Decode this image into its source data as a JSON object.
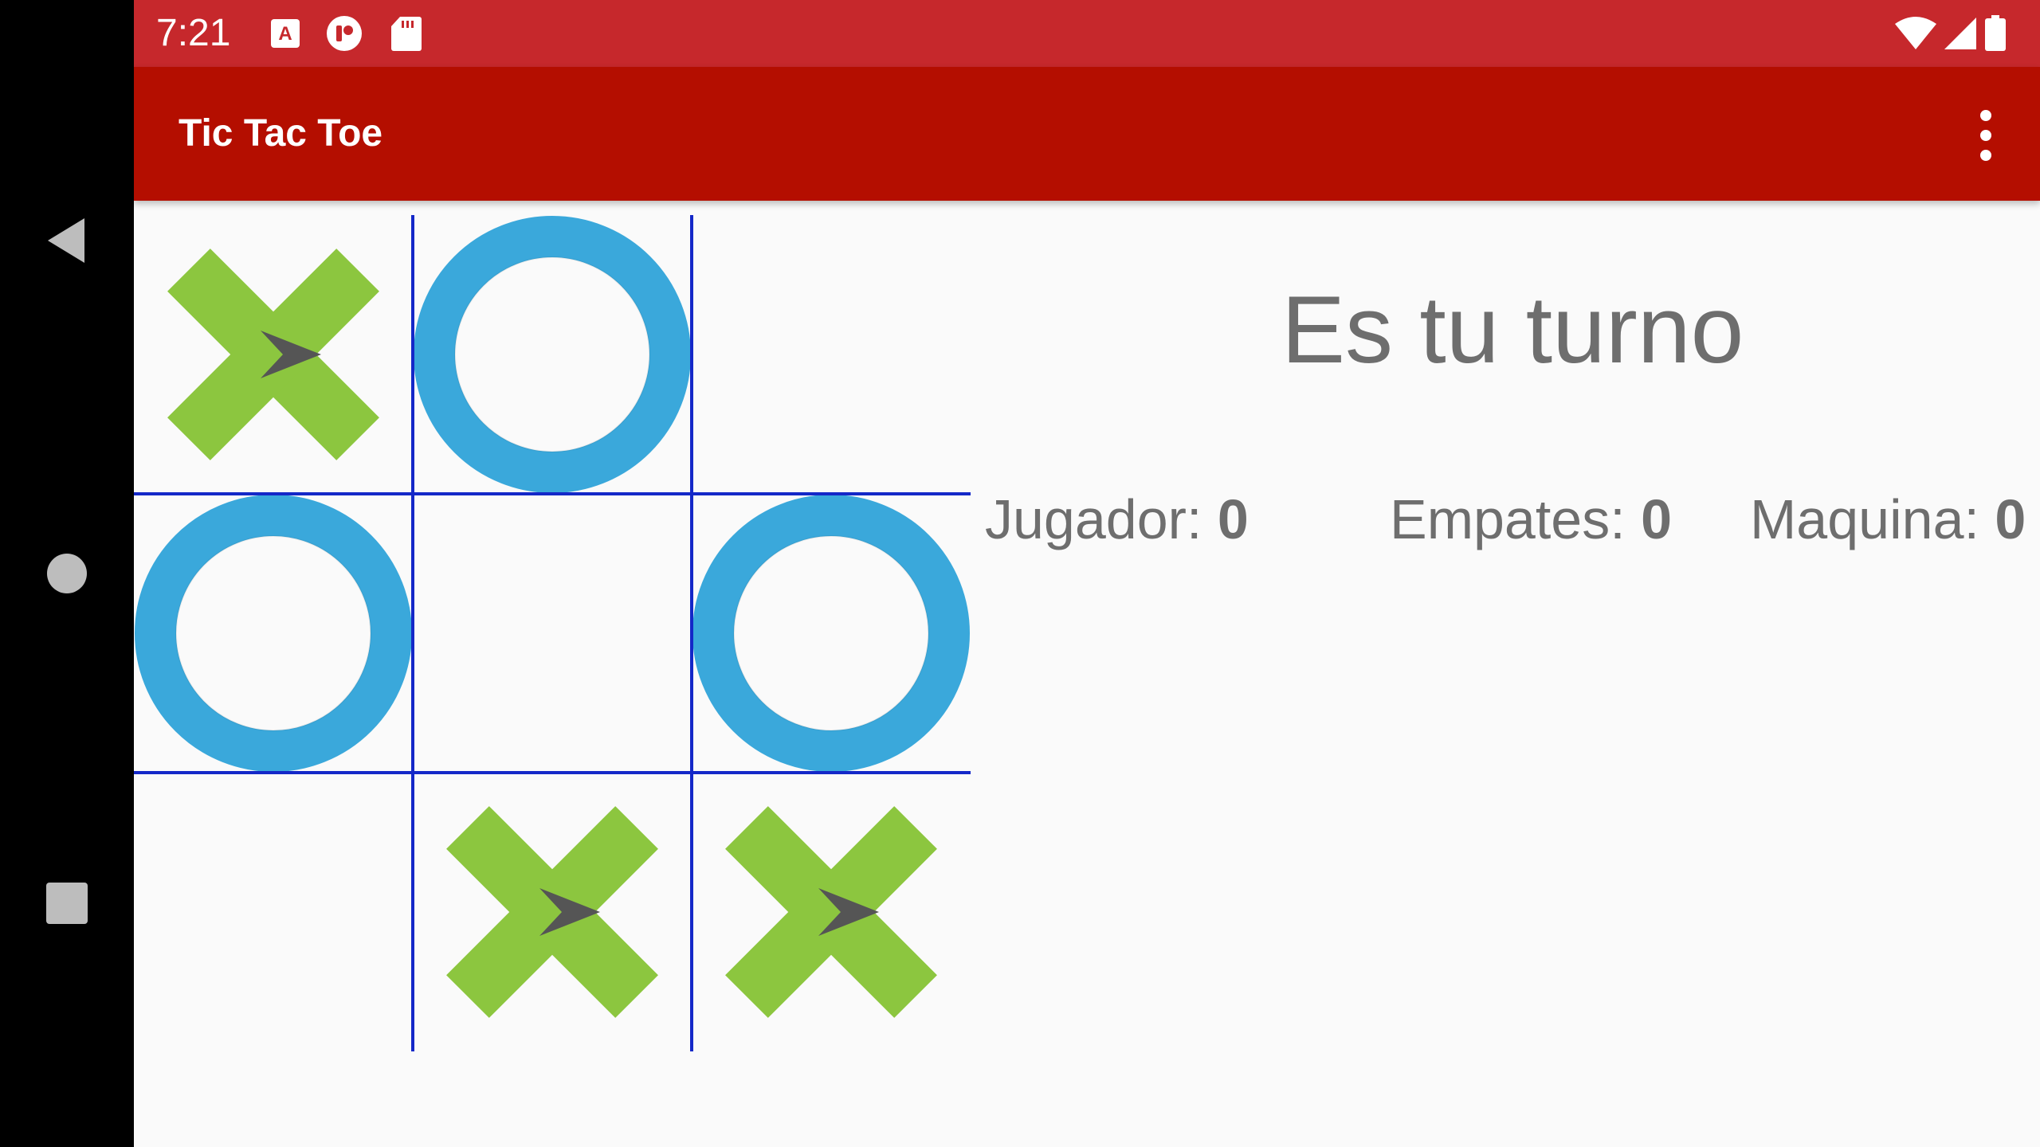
{
  "status_bar": {
    "time": "7:21",
    "icons": [
      "a-notification-icon",
      "opera-icon",
      "sd-card-icon",
      "wifi-icon",
      "signal-icon",
      "battery-icon"
    ]
  },
  "app_bar": {
    "title": "Tic Tac Toe",
    "overflow_icon": "more-vert-icon"
  },
  "colors": {
    "status_bar": "#c6282c",
    "app_bar": "#b40e00",
    "background": "#fafafa",
    "grid": "#1428c8",
    "x_mark": "#8cc63f",
    "o_mark": "#3aa8db",
    "text": "#6e6e6e"
  },
  "game": {
    "board": [
      [
        "X",
        "O",
        ""
      ],
      [
        "O",
        "",
        "O"
      ],
      [
        "",
        "X",
        "X"
      ]
    ],
    "turn_message": "Es tu turno",
    "scores": {
      "player_label": "Jugador:",
      "player_value": "0",
      "ties_label": "Empates:",
      "ties_value": "0",
      "cpu_label": "Maquina:",
      "cpu_value": "0"
    }
  },
  "nav_bar": {
    "icons": [
      "back-icon",
      "home-icon",
      "recents-icon"
    ]
  }
}
